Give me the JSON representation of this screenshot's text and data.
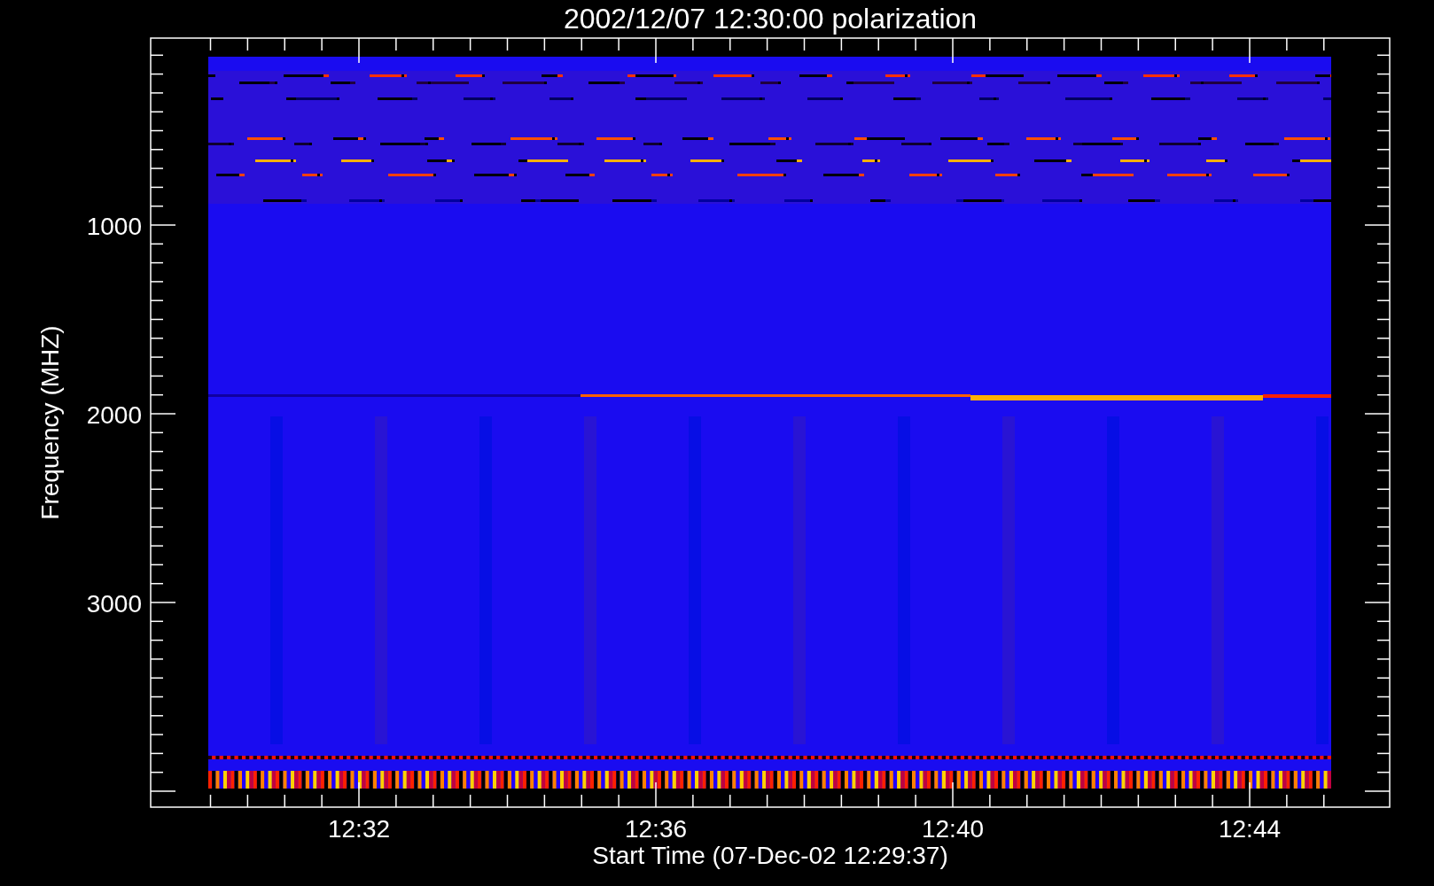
{
  "plot": {
    "title": "2002/12/07 12:30:00 polarization",
    "ylabel": "Frequency (MHZ)",
    "yticks": [
      "1000",
      "2000",
      "3000"
    ],
    "xticks": [
      "12:32",
      "12:36",
      "12:40",
      "12:44"
    ],
    "xlabel": "Start Time (07-Dec-02 12:29:37)"
  }
}
